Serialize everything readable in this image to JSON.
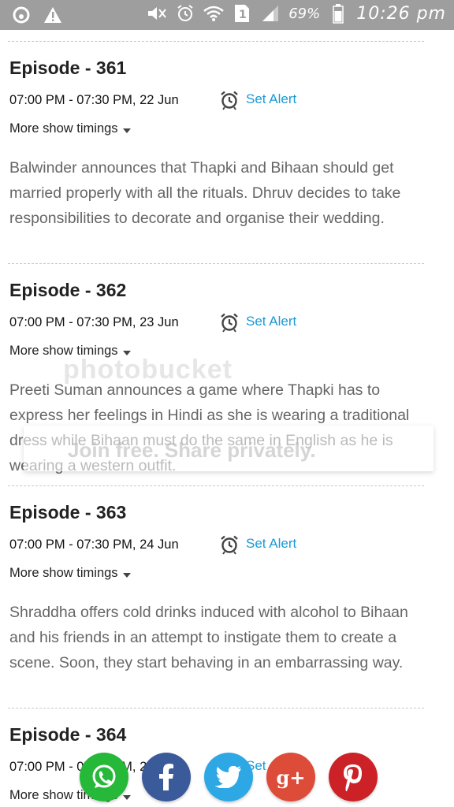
{
  "status_bar": {
    "battery_percent": "69%",
    "clock": "10:26 pm",
    "icons": [
      "app-icon",
      "warning-icon",
      "mute-icon",
      "alarm-icon",
      "wifi-icon",
      "sim-icon",
      "signal-icon",
      "battery-icon"
    ]
  },
  "episodes": [
    {
      "title": "Episode - 361",
      "time": "07:00 PM - 07:30 PM, 22 Jun",
      "alert_label": "Set Alert",
      "more_label": "More show timings",
      "description": "Balwinder announces that Thapki and Bihaan should get married properly with all the rituals. Dhruv decides to take responsibilities to decorate and organise their wedding."
    },
    {
      "title": "Episode - 362",
      "time": "07:00 PM - 07:30 PM, 23 Jun",
      "alert_label": "Set Alert",
      "more_label": "More show timings",
      "description": "Preeti Suman announces a game where Thapki has to express her feelings in Hindi as she is wearing a traditional dress while Bihaan must do the same in English as he is wearing a western outfit."
    },
    {
      "title": "Episode - 363",
      "time": "07:00 PM - 07:30 PM, 24 Jun",
      "alert_label": "Set Alert",
      "more_label": "More show timings",
      "description": "Shraddha offers cold drinks induced with alcohol to Bihaan and his friends in an attempt to instigate them to create a scene. Soon, they start behaving in an embarrassing way."
    },
    {
      "title": "Episode - 364",
      "time": "07:00 PM - 07:30 PM, 25 Jun",
      "alert_label": "Set Alert",
      "more_label": "More show timings"
    }
  ],
  "watermark": {
    "text": "photobucket",
    "sub_text": "Join free. Share privately."
  },
  "share_bar": {
    "buttons": [
      {
        "name": "whatsapp",
        "color": "#25b839"
      },
      {
        "name": "facebook",
        "color": "#3b5a9a"
      },
      {
        "name": "twitter",
        "color": "#2ea8e5"
      },
      {
        "name": "google-plus",
        "color": "#dd4b39"
      },
      {
        "name": "pinterest",
        "color": "#cc2127"
      }
    ],
    "google_plus_label": "g+"
  },
  "colors": {
    "status_bar": "#9e9e9e",
    "link": "#1a9ad6",
    "description_text": "#666666"
  }
}
